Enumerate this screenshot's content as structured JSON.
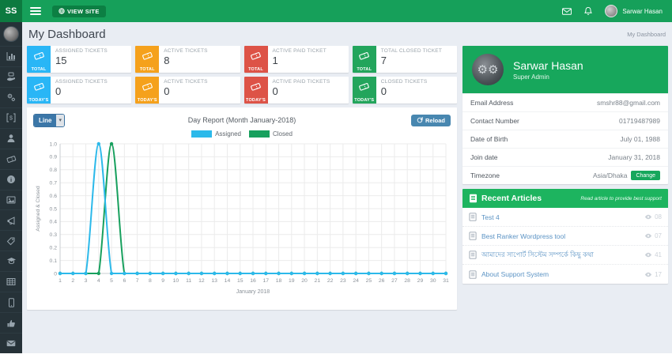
{
  "colors": {
    "navbar_green": "#16a05a",
    "sidebar_dark": "#263238",
    "assigned_cyan": "#2cb9ea",
    "closed_green": "#18a05e",
    "stat_blue": "#29b6f6",
    "stat_orange": "#f5a11c",
    "stat_red": "#dd5347",
    "stat_green": "#23a55c"
  },
  "navbar": {
    "logo": "SS",
    "view_site_label": "VIEW SITE",
    "user_name": "Sarwar Hasan"
  },
  "sidebar": {
    "icons": [
      "user-avatar",
      "bar-chart",
      "support-hand",
      "gears",
      "payment",
      "user",
      "ticket",
      "info",
      "image",
      "announcement",
      "tag",
      "graduation-cap",
      "table",
      "mobile",
      "thumb",
      "envelope"
    ]
  },
  "page": {
    "title": "My Dashboard",
    "breadcrumb": "My Dashboard"
  },
  "stats": [
    {
      "scope": "TOTAL",
      "label": "ASSIGNED TICKETS",
      "value": "15",
      "color": "#29b6f6"
    },
    {
      "scope": "TOTAL",
      "label": "ACTIVE TICKETS",
      "value": "8",
      "color": "#f5a11c"
    },
    {
      "scope": "TOTAL",
      "label": "ACTIVE PAID TICKET",
      "value": "1",
      "color": "#dd5347"
    },
    {
      "scope": "TOTAL",
      "label": "TOTAL CLOSED TICKET",
      "value": "7",
      "color": "#23a55c"
    },
    {
      "scope": "TODAY'S",
      "label": "ASSIGNED TICKETS",
      "value": "0",
      "color": "#29b6f6"
    },
    {
      "scope": "TODAY'S",
      "label": "ACTIVE TICKETS",
      "value": "0",
      "color": "#f5a11c"
    },
    {
      "scope": "TODAY'S",
      "label": "ACTIVE PAID TICKETS",
      "value": "0",
      "color": "#dd5347"
    },
    {
      "scope": "TODAY'S",
      "label": "CLOSED TICKETS",
      "value": "0",
      "color": "#23a55c"
    }
  ],
  "chart_card": {
    "type_selector": "Line",
    "title": "Day Report (Month January-2018)",
    "reload_label": "Reload"
  },
  "chart_data": {
    "type": "line",
    "title": "Day Report (Month January-2018)",
    "x": [
      1,
      2,
      3,
      4,
      5,
      6,
      7,
      8,
      9,
      10,
      11,
      12,
      13,
      14,
      15,
      16,
      17,
      18,
      19,
      20,
      21,
      22,
      23,
      24,
      25,
      26,
      27,
      28,
      29,
      30,
      31
    ],
    "series": [
      {
        "name": "Assigned",
        "color": "#2cb9ea",
        "values": [
          0,
          0,
          0,
          1,
          0,
          0,
          0,
          0,
          0,
          0,
          0,
          0,
          0,
          0,
          0,
          0,
          0,
          0,
          0,
          0,
          0,
          0,
          0,
          0,
          0,
          0,
          0,
          0,
          0,
          0,
          0
        ]
      },
      {
        "name": "Closed",
        "color": "#18a05e",
        "values": [
          0,
          0,
          0,
          0,
          1,
          0,
          0,
          0,
          0,
          0,
          0,
          0,
          0,
          0,
          0,
          0,
          0,
          0,
          0,
          0,
          0,
          0,
          0,
          0,
          0,
          0,
          0,
          0,
          0,
          0,
          0
        ]
      }
    ],
    "xlabel": "January 2018",
    "ylabel": "Assigned & Closed",
    "ylim": [
      0,
      1
    ],
    "ytick_step": 0.1,
    "grid": true,
    "legend_position": "top"
  },
  "profile": {
    "name": "Sarwar Hasan",
    "role": "Super Admin",
    "fields": [
      {
        "label": "Email Address",
        "value": "smshr88@gmail.com"
      },
      {
        "label": "Contact Number",
        "value": "01719487989"
      },
      {
        "label": "Date of Birth",
        "value": "July 01, 1988"
      },
      {
        "label": "Join date",
        "value": "January 31, 2018"
      },
      {
        "label": "Timezone",
        "value": "Asia/Dhaka",
        "action": "Change"
      }
    ]
  },
  "articles": {
    "title": "Recent Articles",
    "subtitle": "Read article to provide best support",
    "items": [
      {
        "title": "Test 4",
        "views": "08"
      },
      {
        "title": "Best Ranker Wordpress tool",
        "views": "07"
      },
      {
        "title": "আমাদের সাপোর্ট সিস্টেম সম্পর্কে কিছু কথা",
        "views": "41"
      },
      {
        "title": "About Support System",
        "views": "17"
      }
    ]
  }
}
